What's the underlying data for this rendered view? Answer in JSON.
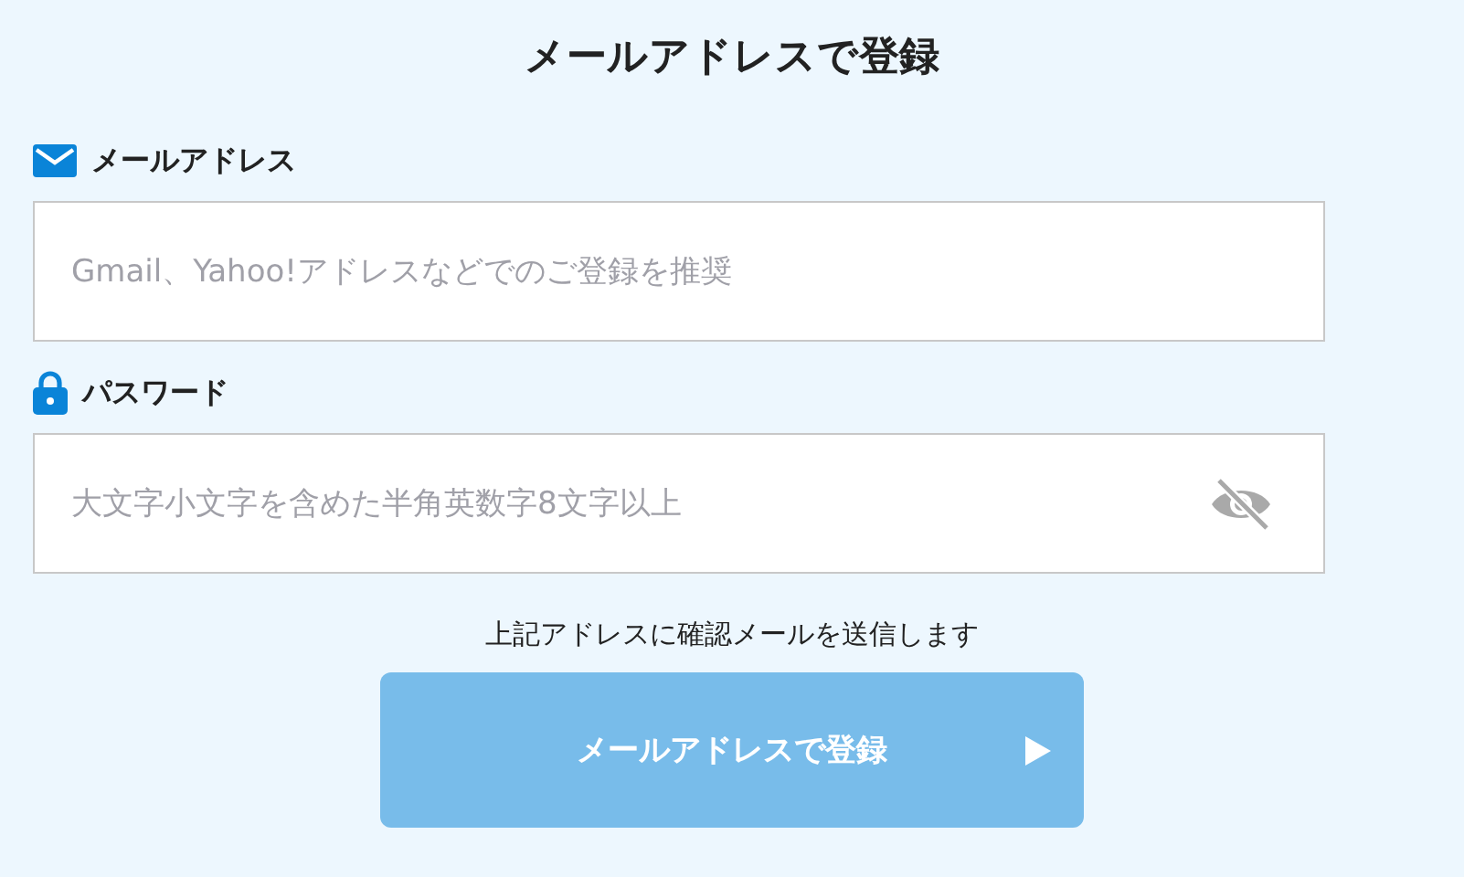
{
  "title": "メールアドレスで登録",
  "fields": [
    {
      "kind": "email",
      "label": "メールアドレス",
      "placeholder": "Gmail、Yahoo!アドレスなどでのご登録を推奨"
    },
    {
      "kind": "password",
      "label": "パスワード",
      "placeholder": "大文字小文字を含めた半角英数字8文字以上"
    }
  ],
  "note": "上記アドレスに確認メールを送信します",
  "submit": {
    "label": "メールアドレスで登録",
    "disabled": true
  }
}
